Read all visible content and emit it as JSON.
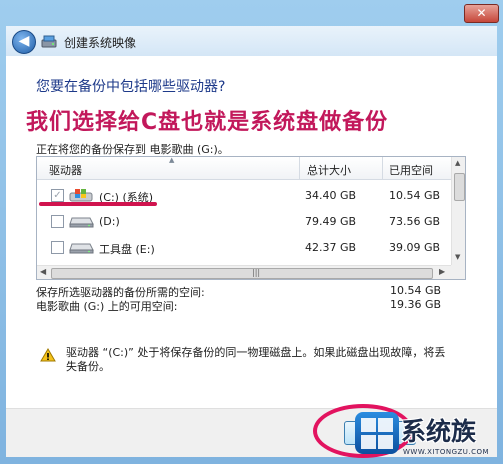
{
  "window": {
    "title": "创建系统映像",
    "close_glyph": "✕",
    "back_glyph": "◀"
  },
  "main": {
    "question": "您要在备份中包括哪些驱动器?",
    "overlay_annotation": "我们选择给C盘也就是系统盘做备份",
    "saving_to": "正在将您的备份保存到 电影歌曲 (G:)。"
  },
  "table": {
    "columns": [
      "驱动器",
      "总计大小",
      "已用空间"
    ],
    "rows": [
      {
        "name": "(C:) (系统)",
        "total": "34.40 GB",
        "used": "10.54 GB",
        "checked": true,
        "disabled": true,
        "icon": "windows-drive-icon"
      },
      {
        "name": "(D:)",
        "total": "79.49 GB",
        "used": "73.56 GB",
        "checked": false,
        "disabled": false,
        "icon": "hard-drive-icon"
      },
      {
        "name": "工具盘 (E:)",
        "total": "42.37 GB",
        "used": "39.09 GB",
        "checked": false,
        "disabled": false,
        "icon": "hard-drive-icon"
      }
    ]
  },
  "space": {
    "required_label": "保存所选驱动器的备份所需的空间:",
    "required_value": "10.54 GB",
    "available_label": "电影歌曲 (G:) 上的可用空间:",
    "available_value": "19.36 GB"
  },
  "warning": {
    "text": "驱动器 “(C:)” 处于将保存备份的同一物理磁盘上。如果此磁盘出现故障，将丢失备份。"
  },
  "watermark": {
    "brand": "系统族",
    "url": "WWW.XITONGZU.COM"
  },
  "colors": {
    "annotation": "#c2185b",
    "question": "#1e3a8a",
    "highlight": "#e2135f"
  }
}
